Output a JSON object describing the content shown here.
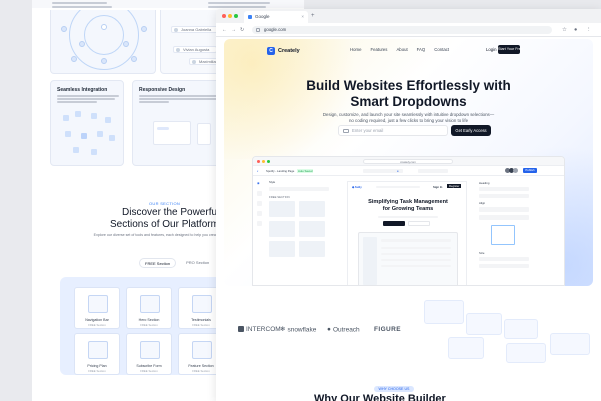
{
  "bg_page": {
    "section_badge": "OUR SECTION",
    "section_title_line1": "Discover the Powerful",
    "section_title_line2": "Sections of Our Platform",
    "section_subtitle": "Explore our diverse set of tools and features, each designed to help you create and optimize your website effortlessly.",
    "tab_active": "FREE Section",
    "tab_inactive": "PRO Section",
    "feature_cards": [
      {
        "title": "Seamless Integration"
      },
      {
        "title": "Responsive Design"
      }
    ],
    "user_chips": [
      "Joanna Gabriella",
      "Vivian Augusta",
      "Maximilian Bernet"
    ],
    "section_grid": [
      {
        "label": "Navigation Bar",
        "sub": "FREE Section"
      },
      {
        "label": "Hero Section",
        "sub": "FREE Section"
      },
      {
        "label": "Testimonials",
        "sub": "FREE Section"
      },
      {
        "label": "Pricing Plan",
        "sub": "FREE Section"
      },
      {
        "label": "Subscribe Form",
        "sub": "FREE Section"
      },
      {
        "label": "Feature Section",
        "sub": "FREE Section"
      }
    ]
  },
  "browser": {
    "tab_title": "Google",
    "url": "google.com",
    "traffic_lights": [
      "#ff5f57",
      "#febc2e",
      "#28c840"
    ]
  },
  "site": {
    "brand": "Creately",
    "brand_mark": "C",
    "nav": [
      "Home",
      "Features",
      "About",
      "FAQ",
      "Contact"
    ],
    "login": "Login",
    "get_free": "Start Your Free",
    "hero_title_line1": "Build Websites Effortlessly with",
    "hero_title_line2": "Smart Dropdowns",
    "hero_sub_line1": "Design, customize, and launch your site seamlessly with intuitive dropdown selections—",
    "hero_sub_line2": "no coding required, just a few clicks to bring your vision to life",
    "email_placeholder": "Enter your email",
    "cta": "Get Early Access",
    "accent": "#2563eb"
  },
  "app_mock": {
    "url": "creately.com",
    "page_name": "Spotify - Landing Page",
    "status": "Auto Saved",
    "sign_in": "Sign In",
    "register": "Register",
    "publish": "Publish",
    "canvas_title_line1": "Simplifying Task Management",
    "canvas_title_line2": "for Growing Teams",
    "style_label": "Style",
    "free_section": "FREE SECTION",
    "heading": "Heading",
    "align": "Align",
    "size": "Size"
  },
  "partner_logos": [
    "INTERCOM",
    "snowflake",
    "Outreach",
    "FIGURE"
  ],
  "why": {
    "badge": "WHY CHOOSE US",
    "title": "Why Our Website Builder"
  }
}
